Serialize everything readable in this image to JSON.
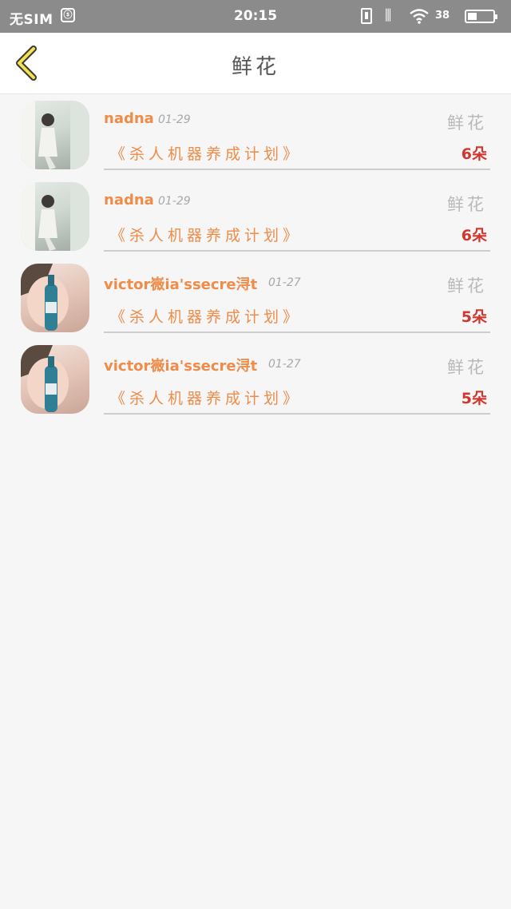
{
  "status_bar": {
    "carrier": "无SIM",
    "time": "20:15",
    "battery_percent": "38",
    "battery_level": 0.38,
    "icons": [
      "app-notification-icon",
      "battery-saver-icon",
      "vibrate-icon",
      "wifi-icon",
      "battery-icon"
    ]
  },
  "header": {
    "back_icon": "chevron-left-icon",
    "title": "鲜花"
  },
  "colors": {
    "username": "#ee8c4a",
    "count": "#d1372f",
    "back_icon": "#f6e24a"
  },
  "records": [
    {
      "username": "nadna",
      "date": "01-29",
      "type": "鲜花",
      "book": "《杀人机器养成计划》",
      "count": "6朵"
    },
    {
      "username": "nadna",
      "date": "01-29",
      "type": "鲜花",
      "book": "《杀人机器养成计划》",
      "count": "6朵"
    },
    {
      "username": "victor嶶ia'ssecre浔t",
      "date": "01-27",
      "type": "鲜花",
      "book": "《杀人机器养成计划》",
      "count": "5朵"
    },
    {
      "username": "victor嶶ia'ssecre浔t",
      "date": "01-27",
      "type": "鲜花",
      "book": "《杀人机器养成计划》",
      "count": "5朵"
    }
  ]
}
